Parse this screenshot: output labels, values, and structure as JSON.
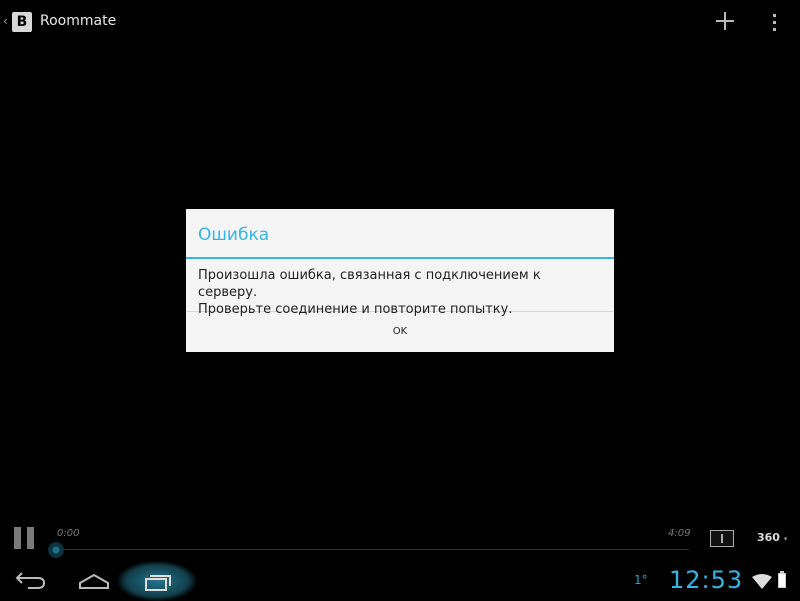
{
  "actionbar": {
    "back_glyph": "‹",
    "logo_letter": "B",
    "title": "Roommate"
  },
  "dialog": {
    "title": "Ошибка",
    "message_line1": "Произошла ошибка, связанная с подключением к серверу.",
    "message_line2": "Проверьте соединение и повторите попытку.",
    "ok_label": "OK"
  },
  "player": {
    "current_time": "0:00",
    "total_time": "4:09",
    "progress": 0.0,
    "quality_label": "360",
    "quality_caret": "▾"
  },
  "systembar": {
    "notification": "1°",
    "clock": "12:53"
  },
  "colors": {
    "accent": "#33b5e5",
    "background": "#000000",
    "dialog_bg": "#f5f5f5"
  },
  "icons": [
    "chevron-left-icon",
    "plus-icon",
    "overflow-icon",
    "pause-icon",
    "fit-screen-icon",
    "nav-back-icon",
    "nav-home-icon",
    "nav-recents-icon",
    "wifi-icon",
    "battery-icon"
  ]
}
